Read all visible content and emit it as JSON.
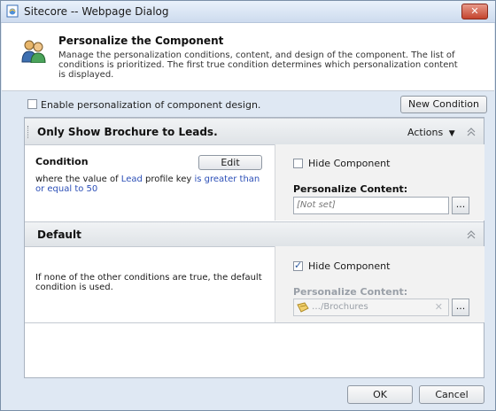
{
  "window": {
    "title": "Sitecore -- Webpage Dialog",
    "close_label": "✕"
  },
  "header": {
    "title": "Personalize the Component",
    "description": "Manage the personalization conditions, content, and design of the component. The list of conditions is prioritized. The first true condition determines which personalization content is displayed."
  },
  "toolbar": {
    "enable_label": "Enable personalization of component design.",
    "new_condition_label": "New Condition"
  },
  "rule1": {
    "title": "Only Show Brochure to Leads.",
    "actions_label": "Actions",
    "condition_label": "Condition",
    "edit_label": "Edit",
    "text_prefix": "where the value of ",
    "text_link1": "Lead",
    "text_middle": " profile key ",
    "text_link2": "is greater than or equal to 50",
    "hide_label": "Hide Component",
    "hide_checked": false,
    "personalize_label": "Personalize Content:",
    "content_value": "[Not set]",
    "browse_label": "..."
  },
  "default_rule": {
    "title": "Default",
    "description": "If none of the other conditions are true, the default condition is used.",
    "hide_label": "Hide Component",
    "hide_checked": true,
    "personalize_label": "Personalize Content:",
    "content_value": "…/Brochures",
    "clear_label": "✕",
    "browse_label": "..."
  },
  "footer": {
    "ok_label": "OK",
    "cancel_label": "Cancel"
  }
}
